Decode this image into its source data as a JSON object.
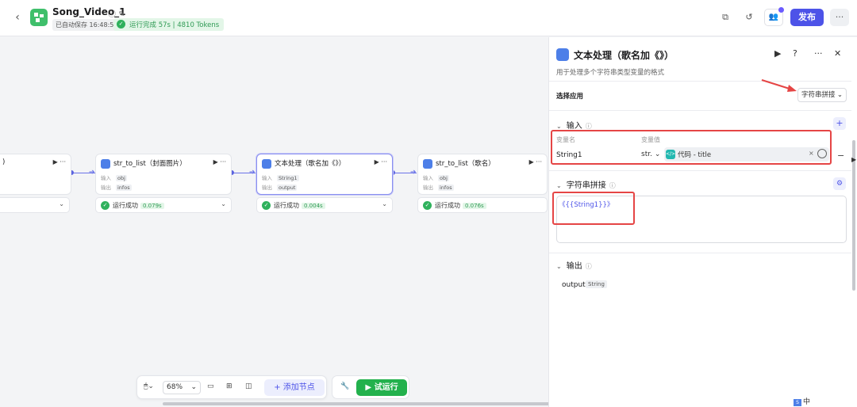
{
  "header": {
    "app_title": "Song_Video_1",
    "autosave": "已自动保存 16:48:51",
    "run_status": "运行完成 57s | 4810 Tokens",
    "publish_label": "发布"
  },
  "nodes": [
    {
      "title": ")",
      "result": "",
      "time": ""
    },
    {
      "title": "str_to_list（封面图片）",
      "in_label": "输入",
      "in_val": "obj",
      "out_label": "输出",
      "out_val": "infos",
      "result": "运行成功",
      "time": "0.079s"
    },
    {
      "title": "文本处理（歌名加《》）",
      "in_label": "输入",
      "in_val": "String1",
      "out_label": "输出",
      "out_val": "output",
      "result": "运行成功",
      "time": "0.004s"
    },
    {
      "title": "str_to_list（歌名）",
      "in_label": "输入",
      "in_val": "obj",
      "out_label": "输出",
      "out_val": "infos",
      "result": "运行成功",
      "time": "0.076s"
    }
  ],
  "toolbar": {
    "zoom": "68%",
    "add_node_label": "+ 添加节点",
    "try_run_label": "试运行"
  },
  "panel": {
    "title": "文本处理（歌名加《》）",
    "description": "用于处理多个字符串类型变量的格式",
    "select_app_label": "选择应用",
    "select_app_value": "字符串拼接",
    "input_section": "输入",
    "col_name": "变量名",
    "col_value": "变量值",
    "var_name": "String1",
    "var_type": "str.",
    "var_value": "代码 - title",
    "concat_section": "字符串拼接",
    "concat_template": "《{{String1}}》",
    "output_section": "输出",
    "output_name": "output",
    "output_type": "String"
  },
  "ime": {
    "label": "中"
  },
  "colors": {
    "primary": "#4d53e8",
    "success": "#2fb15c",
    "highlight": "#e54545"
  }
}
